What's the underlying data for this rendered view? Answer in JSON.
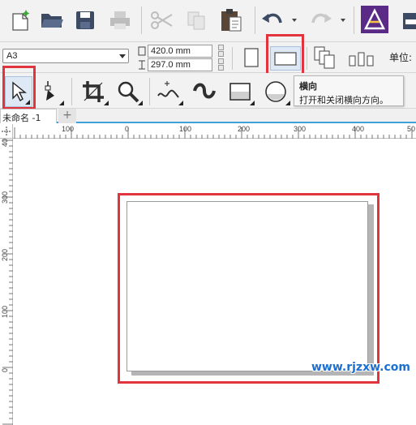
{
  "standard_toolbar": {
    "icons": [
      "new-document-icon",
      "open-folder-icon",
      "save-icon",
      "print-icon",
      "cut-icon",
      "copy-icon",
      "paste-icon",
      "undo-icon",
      "redo-icon",
      "app-launcher-icon",
      "publish-icon"
    ]
  },
  "property_bar": {
    "paper_size": "A3",
    "width_value": "420.0 mm",
    "height_value": "297.0 mm",
    "units_label": "单位:"
  },
  "tooltip": {
    "title": "横向",
    "description": "打开和关闭横向方向。"
  },
  "document": {
    "tab_label": "未命名 -1",
    "new_tab_symbol": "+"
  },
  "rulers": {
    "horizontal_labels": [
      "100",
      "0",
      "100",
      "200",
      "300",
      "400",
      "50"
    ],
    "vertical_labels": [
      "300",
      "200",
      "100",
      "0"
    ],
    "top_corner_label": "40"
  },
  "watermark": "www.rjzxw.com",
  "colors": {
    "highlight": "#e2343c",
    "tab_accent": "#3ea1d9",
    "watermark": "#1d6fd1"
  }
}
